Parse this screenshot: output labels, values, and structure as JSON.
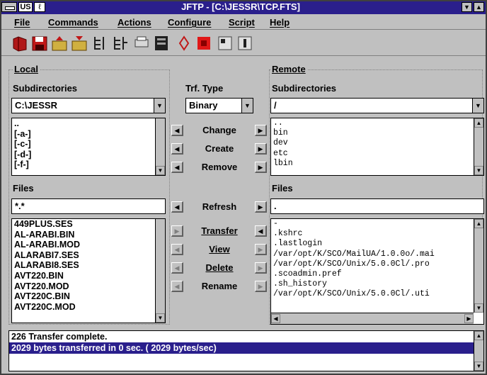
{
  "window": {
    "title": "JFTP - [C:\\JESSR\\TCP.FTS]",
    "lang_indicator": "US",
    "lang_extra": "ℓ"
  },
  "menu": [
    "File",
    "Commands",
    "Actions",
    "Configure",
    "Script",
    "Help"
  ],
  "toolbar_icons": [
    "connect-icon",
    "save-icon",
    "upload-icon",
    "download-icon",
    "tree-icon",
    "compare-icon",
    "print-icon",
    "terminal-icon",
    "settings-icon",
    "stop-icon",
    "binary-icon",
    "ascii-icon"
  ],
  "local": {
    "group_label": "Local",
    "subdir_label": "Subdirectories",
    "path": "C:\\JESSR",
    "dirs": [
      "..",
      "[-a-]",
      "[-c-]",
      "[-d-]",
      "[-f-]"
    ],
    "files_label": "Files",
    "filter": "*.*",
    "files": [
      "449PLUS.SES",
      "AL-ARABI.BIN",
      "AL-ARABI.MOD",
      "ALARABI7.SES",
      "ALARABI8.SES",
      "AVT220.BIN",
      "AVT220.MOD",
      "AVT220C.BIN",
      "AVT220C.MOD"
    ]
  },
  "remote": {
    "group_label": "Remote",
    "subdir_label": "Subdirectories",
    "path": "/",
    "dirs": [
      "..",
      "bin",
      "dev",
      "etc",
      "lbin"
    ],
    "files_label": "Files",
    "filter": ".",
    "files": [
      "-",
      ".kshrc",
      ".lastlogin",
      "/var/opt/K/SCO/MailUA/1.0.0o/.mai",
      "/var/opt/K/SCO/Unix/5.0.0Cl/.pro",
      ".scoadmin.pref",
      ".sh_history",
      "/var/opt/K/SCO/Unix/5.0.0Cl/.uti"
    ]
  },
  "transfer": {
    "type_label": "Trf. Type",
    "type_value": "Binary",
    "buttons": {
      "change": "Change",
      "create": "Create",
      "remove": "Remove",
      "refresh": "Refresh",
      "transfer": "Transfer",
      "view": "View",
      "delete": "Delete",
      "rename": "Rename"
    }
  },
  "status": {
    "lines": [
      "226 Transfer complete.",
      "2029 bytes transferred in 0 sec. ( 2029 bytes/sec)"
    ]
  },
  "colors": {
    "titlebar": "#2a1f8c",
    "selection": "#2a1f8c",
    "face": "#c0c0c0"
  }
}
